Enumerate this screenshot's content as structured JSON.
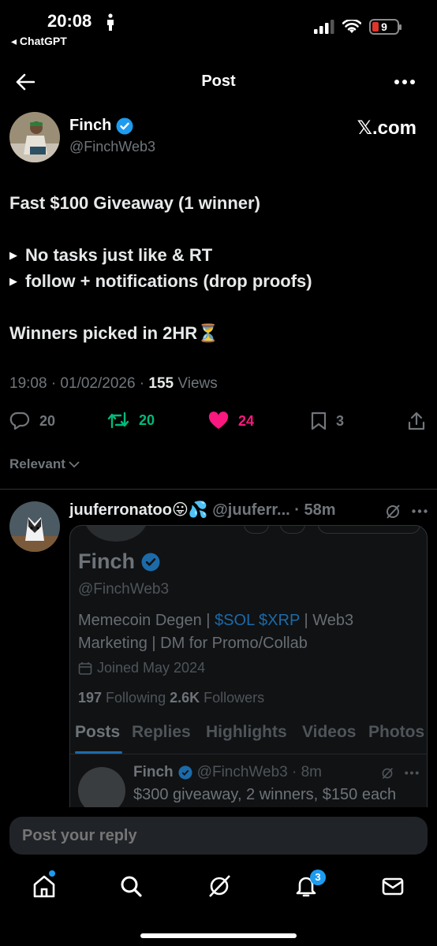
{
  "status_bar": {
    "time": "20:08",
    "back_app": "◂ ChatGPT",
    "battery": "9"
  },
  "header": {
    "title": "Post"
  },
  "post": {
    "author_name": "Finch",
    "author_handle": "@FinchWeb3",
    "source": "𝕏.com",
    "line1": "Fast $100 Giveaway (1 winner)",
    "bullet1": "No tasks just like & RT",
    "bullet2": "follow + notifications (drop proofs)",
    "line3": "Winners picked in 2HR⏳",
    "timestamp": "19:08 · 01/02/2026 · ",
    "views_count": "155",
    "views_label": " Views",
    "replies": "20",
    "reposts": "20",
    "likes": "24",
    "bookmarks": "3"
  },
  "sort": {
    "label": "Relevant"
  },
  "reply": {
    "name": "juuferronatoo😛💦",
    "handle": " @juuferr...",
    "time": " · 58m",
    "embed": {
      "name": "Finch",
      "handle": "@FinchWeb3",
      "bio_part1": "Memecoin Degen | ",
      "bio_sol": "$SOL",
      "bio_space": " ",
      "bio_xrp": "$XRP",
      "bio_part2": " | Web3 Marketing | DM for Promo/Collab",
      "joined": "Joined May 2024",
      "following_count": "197",
      "following_label": " Following  ",
      "followers_count": "2.6K",
      "followers_label": " Followers",
      "tabs": [
        "Posts",
        "Replies",
        "Highlights",
        "Videos",
        "Photos"
      ],
      "post_name": "Finch",
      "post_handle": "@FinchWeb3 · 8m",
      "post_text": "$300 giveaway, 2 winners, $150 each"
    }
  },
  "composer": {
    "placeholder": "Post your reply"
  },
  "tabbar": {
    "notifications_badge": "3"
  },
  "colors": {
    "accent": "#1d9bf0",
    "like": "#f91880",
    "repost": "#00ba7c",
    "muted": "#71767b"
  }
}
